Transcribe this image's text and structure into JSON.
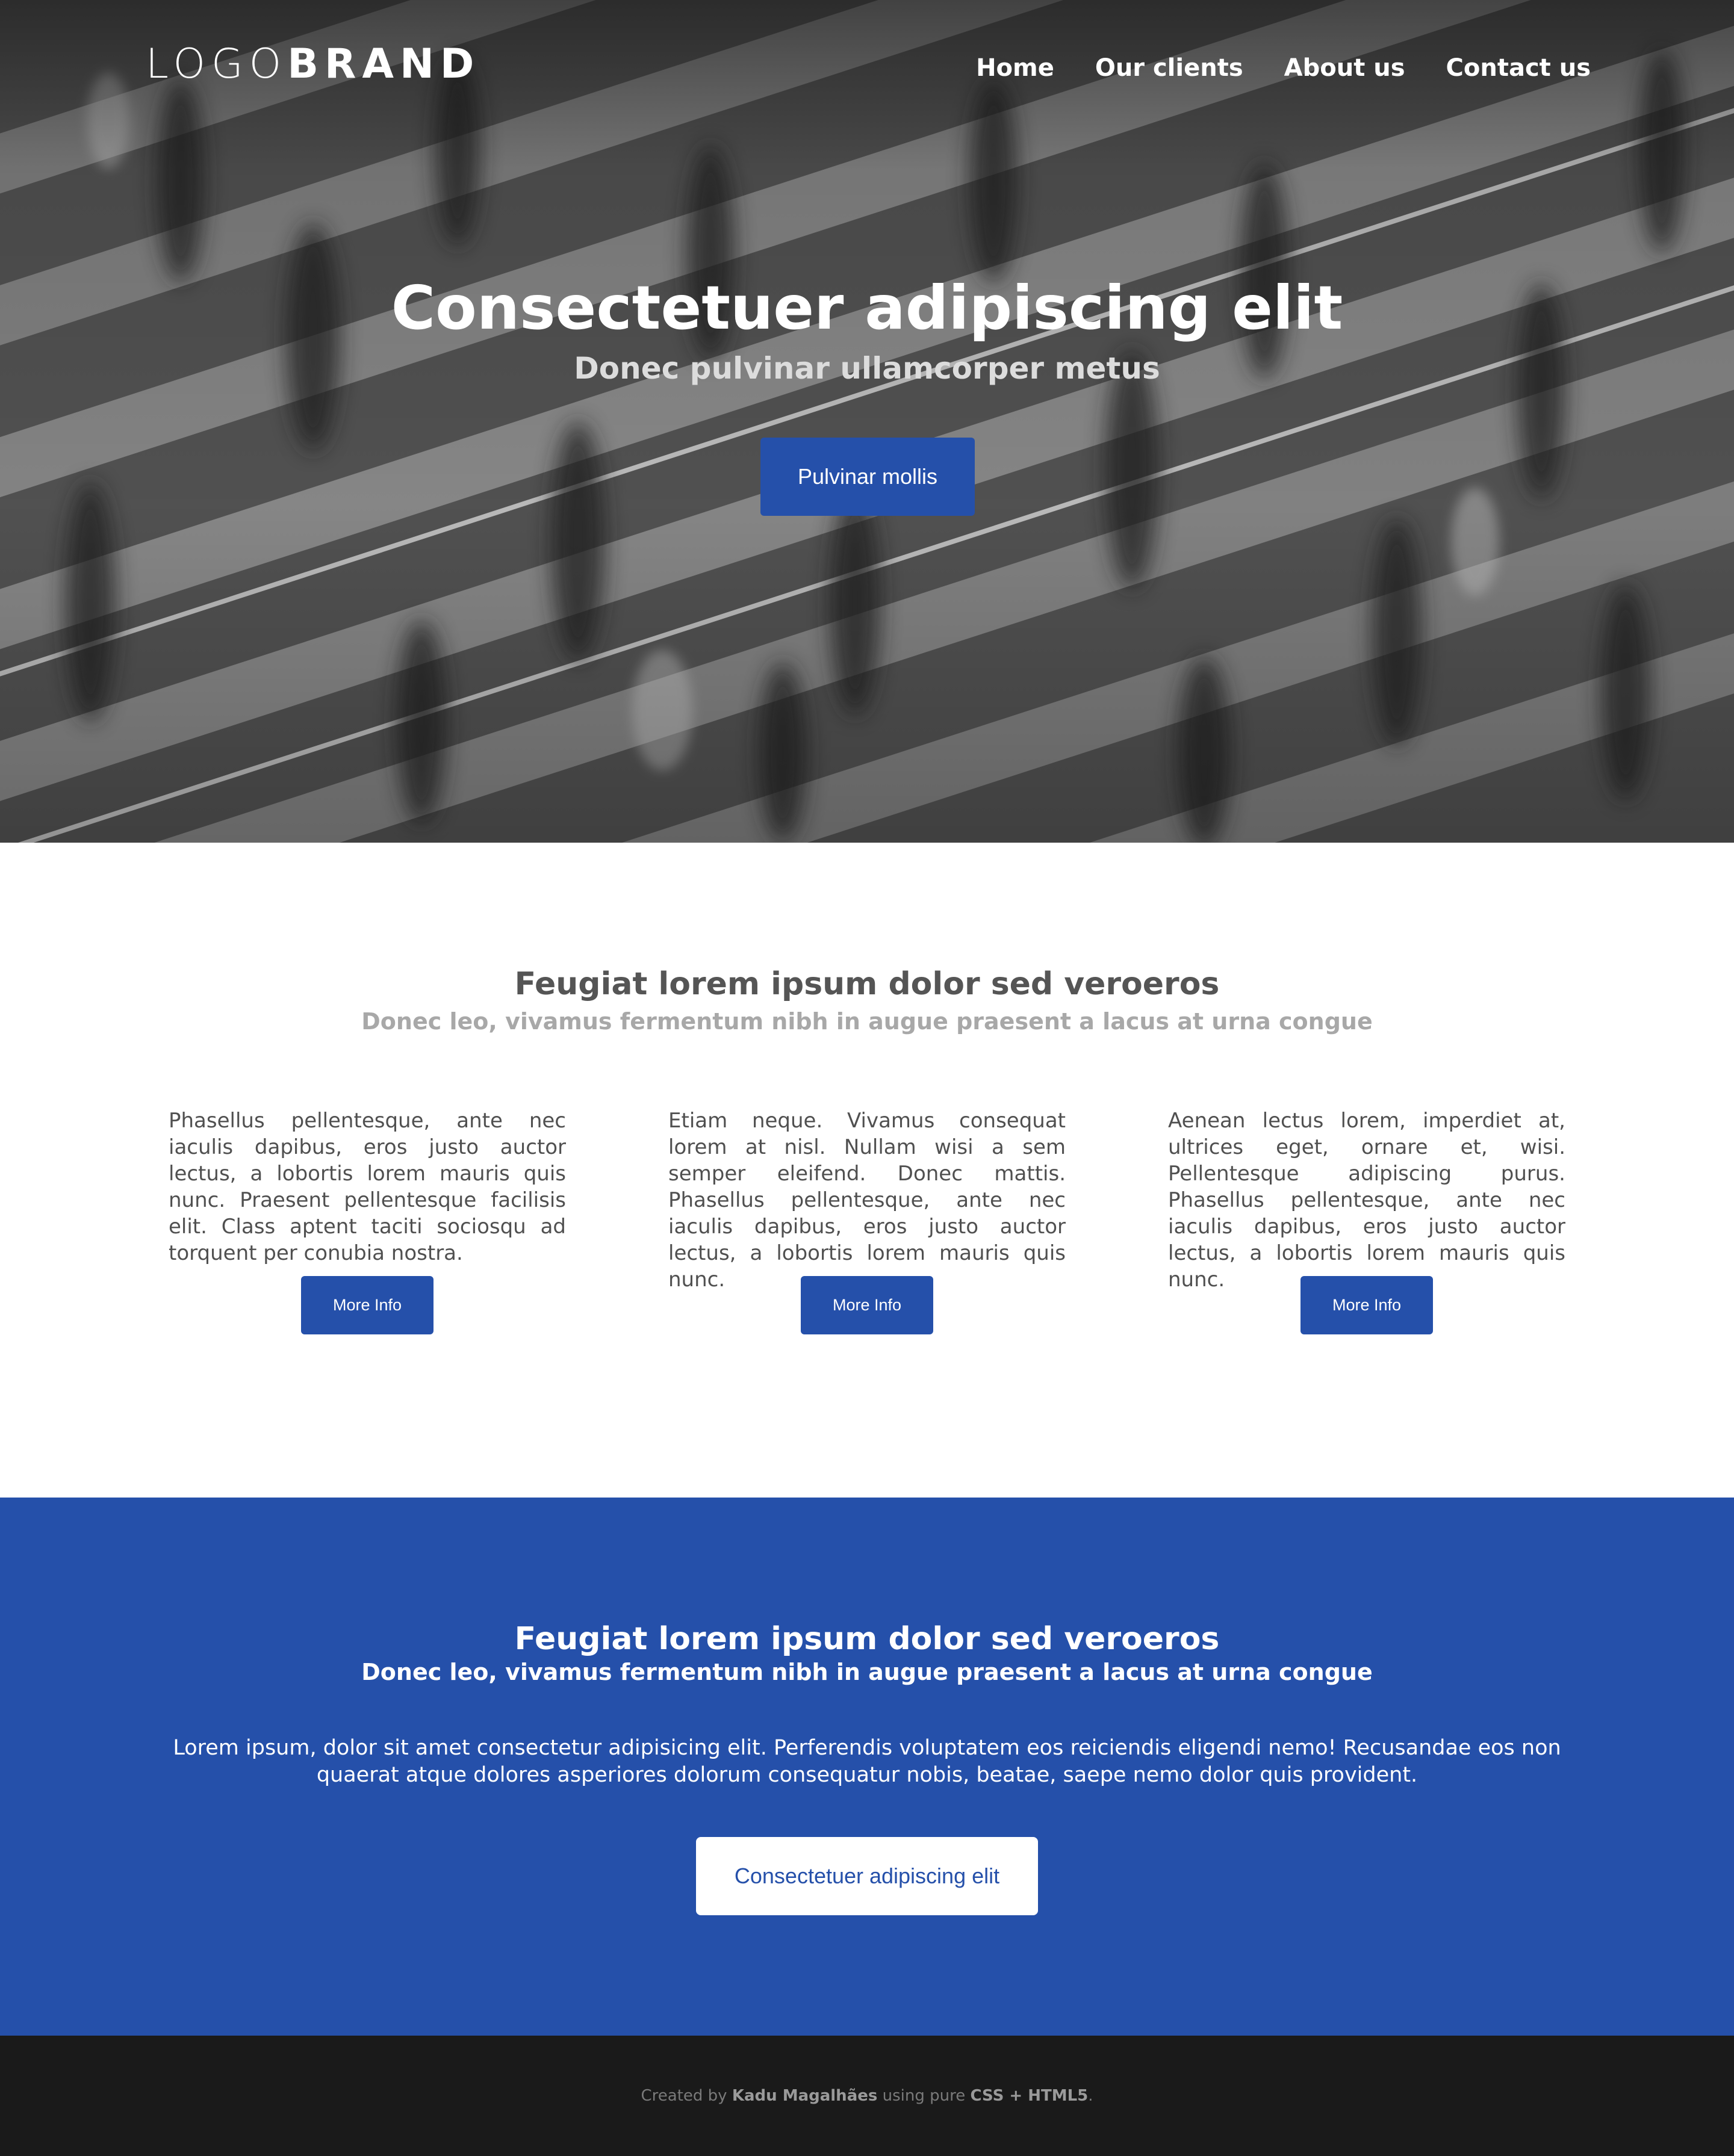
{
  "logo": {
    "light": "LOGO",
    "bold": "BRAND"
  },
  "nav": {
    "items": [
      "Home",
      "Our clients",
      "About us",
      "Contact us"
    ]
  },
  "hero": {
    "title": "Consectetuer adipiscing elit",
    "subtitle": "Donec pulvinar ullamcorper metus",
    "button": "Pulvinar mollis"
  },
  "features": {
    "title": "Feugiat lorem ipsum dolor sed veroeros",
    "subtitle": "Donec leo, vivamus fermentum nibh in augue praesent a lacus at urna congue",
    "columns": [
      {
        "text": "Phasellus pellentesque, ante nec iaculis dapibus, eros justo auctor lectus, a lobortis lorem mauris quis nunc. Praesent pellentesque facilisis elit. Class aptent taciti sociosqu ad torquent per conubia nostra.",
        "button": "More Info"
      },
      {
        "text": "Etiam neque. Vivamus consequat lorem at nisl. Nullam wisi a sem semper eleifend. Donec mattis. Phasellus pellentesque, ante nec iaculis dapibus, eros justo auctor lectus, a lobortis lorem mauris quis nunc.",
        "button": "More Info"
      },
      {
        "text": "Aenean lectus lorem, imperdiet at, ultrices eget, ornare et, wisi. Pellentesque adipiscing purus. Phasellus pellentesque, ante nec iaculis dapibus, eros justo auctor lectus, a lobortis lorem mauris quis nunc.",
        "button": "More Info"
      }
    ]
  },
  "cta": {
    "title": "Feugiat lorem ipsum dolor sed veroeros",
    "subtitle": "Donec leo, vivamus fermentum nibh in augue praesent a lacus at urna congue",
    "text": "Lorem ipsum, dolor sit amet consectetur adipisicing elit. Perferendis voluptatem eos reiciendis eligendi nemo! Recusandae eos non quaerat atque dolores asperiores dolorum consequatur nobis, beatae, saepe nemo dolor quis provident.",
    "button": "Consectetuer adipiscing elit"
  },
  "footer": {
    "prefix": "Created by",
    "author": "Kadu Magalhães",
    "middle": "using pure",
    "tech": "CSS + HTML5",
    "suffix": "."
  },
  "colors": {
    "accent": "#2550aa",
    "footer_bg": "#1a1a1a",
    "hero_bg": "#5a5a5a"
  }
}
